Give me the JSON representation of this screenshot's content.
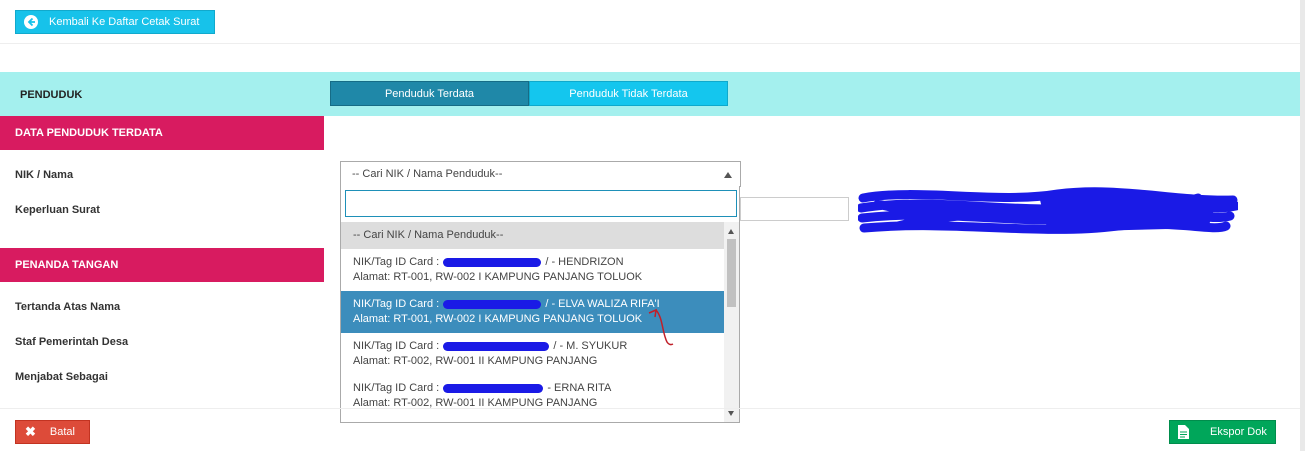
{
  "header": {
    "back_button_label": "Kembali Ke Daftar Cetak Surat",
    "back_icon": "arrow-left-circle-icon"
  },
  "penduduk_bar": {
    "label": "PENDUDUK",
    "tabs": [
      {
        "label": "Penduduk Terdata",
        "active": true
      },
      {
        "label": "Penduduk Tidak Terdata",
        "active": false
      }
    ]
  },
  "sections": {
    "data_penduduk": "DATA PENDUDUK TERDATA",
    "penanda_tangan": "PENANDA TANGAN"
  },
  "fields": {
    "nik_nama": "NIK / Nama",
    "keperluan_surat": "Keperluan Surat",
    "tertanda_atas_nama": "Tertanda Atas Nama",
    "staf_pemerintah_desa": "Staf Pemerintah Desa",
    "menjabat_sebagai": "Menjabat Sebagai"
  },
  "select": {
    "current_value": "-- Cari NIK / Nama Penduduk--",
    "search_value": "",
    "options": [
      {
        "text": "-- Cari NIK / Nama Penduduk--"
      },
      {
        "line1_prefix": "NIK/Tag ID Card :",
        "line1_suffix": "/ - HENDRIZON",
        "line2": "Alamat: RT-001, RW-002 I KAMPUNG PANJANG TOLUOK"
      },
      {
        "line1_prefix": "NIK/Tag ID Card :",
        "line1_suffix": "/ - ELVA WALIZA RIFA'I",
        "line2": "Alamat: RT-001, RW-002 I KAMPUNG PANJANG TOLUOK"
      },
      {
        "line1_prefix": "NIK/Tag ID Card :",
        "line1_suffix": "/ - M. SYUKUR",
        "line2": "Alamat: RT-002, RW-001 II KAMPUNG PANJANG"
      },
      {
        "line1_prefix": "NIK/Tag ID Card :",
        "line1_suffix": "- ERNA RITA",
        "line2": "Alamat: RT-002, RW-001 II KAMPUNG PANJANG"
      }
    ]
  },
  "footer": {
    "batal_label": "Batal",
    "ekspor_label": "Ekspor Dok",
    "batal_icon": "close-icon",
    "ekspor_icon": "document-icon"
  },
  "colors": {
    "cyan_bar": "#a4f0ee",
    "section_head": "#d81b60",
    "tab_active": "#1f88a8",
    "tab_inactive": "#14c6ee",
    "selected_option": "#3c8dbc",
    "batal": "#dd4b39",
    "ekspor": "#00a65a",
    "redaction": "#1a1ae6"
  }
}
